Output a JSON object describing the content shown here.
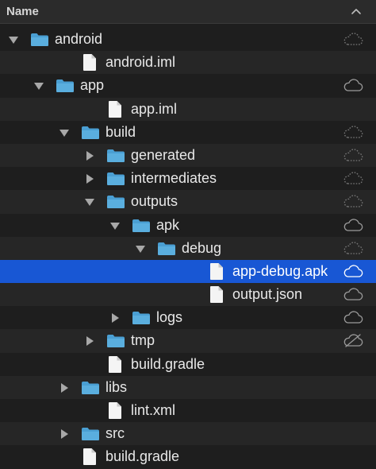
{
  "header": {
    "title": "Name",
    "sort_icon": "chevron-up-icon"
  },
  "colors": {
    "background": "#1e1e1e",
    "row_alt": "#262626",
    "selected": "#1857d4",
    "folder": "#5aaede",
    "file": "#f4f4f4",
    "text": "#e8e8e8",
    "cloud": "#9a9a9a"
  },
  "rows": [
    {
      "name": "android",
      "type": "folder",
      "depth": 0,
      "disclosure": "expanded",
      "cloud": "dashed"
    },
    {
      "name": "android.iml",
      "type": "file",
      "depth": 1,
      "disclosure": "none",
      "cloud": "none"
    },
    {
      "name": "app",
      "type": "folder",
      "depth": 1,
      "disclosure": "expanded",
      "cloud": "solid"
    },
    {
      "name": "app.iml",
      "type": "file",
      "depth": 2,
      "disclosure": "none",
      "cloud": "none"
    },
    {
      "name": "build",
      "type": "folder",
      "depth": 2,
      "disclosure": "expanded",
      "cloud": "dashed"
    },
    {
      "name": "generated",
      "type": "folder",
      "depth": 3,
      "disclosure": "collapsed",
      "cloud": "dashed"
    },
    {
      "name": "intermediates",
      "type": "folder",
      "depth": 3,
      "disclosure": "collapsed",
      "cloud": "dashed"
    },
    {
      "name": "outputs",
      "type": "folder",
      "depth": 3,
      "disclosure": "expanded",
      "cloud": "dashed"
    },
    {
      "name": "apk",
      "type": "folder",
      "depth": 4,
      "disclosure": "expanded",
      "cloud": "solid"
    },
    {
      "name": "debug",
      "type": "folder",
      "depth": 5,
      "disclosure": "expanded",
      "cloud": "dashed"
    },
    {
      "name": "app-debug.apk",
      "type": "file",
      "depth": 6,
      "disclosure": "none",
      "cloud": "solid",
      "selected": true
    },
    {
      "name": "output.json",
      "type": "file",
      "depth": 6,
      "disclosure": "none",
      "cloud": "solid"
    },
    {
      "name": "logs",
      "type": "folder",
      "depth": 4,
      "disclosure": "collapsed",
      "cloud": "solid"
    },
    {
      "name": "tmp",
      "type": "folder",
      "depth": 3,
      "disclosure": "collapsed",
      "cloud": "slashed"
    },
    {
      "name": "build.gradle",
      "type": "file",
      "depth": 2,
      "disclosure": "none",
      "cloud": "none"
    },
    {
      "name": "libs",
      "type": "folder",
      "depth": 2,
      "disclosure": "collapsed",
      "cloud": "none"
    },
    {
      "name": "lint.xml",
      "type": "file",
      "depth": 2,
      "disclosure": "none",
      "cloud": "none"
    },
    {
      "name": "src",
      "type": "folder",
      "depth": 2,
      "disclosure": "collapsed",
      "cloud": "none"
    },
    {
      "name": "build.gradle",
      "type": "file",
      "depth": 1,
      "disclosure": "none",
      "cloud": "none"
    }
  ]
}
